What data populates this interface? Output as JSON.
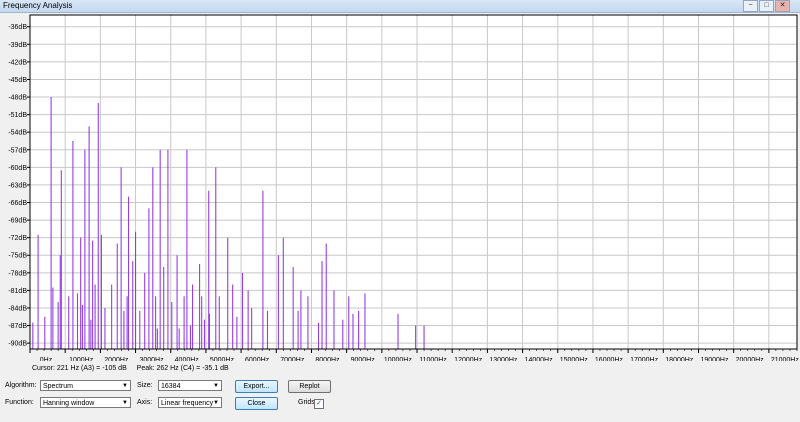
{
  "window": {
    "title": "Frequency Analysis",
    "controls": [
      "−",
      "□",
      "✕"
    ]
  },
  "chart_data": {
    "type": "bar",
    "title": "",
    "xlabel": "",
    "ylabel": "",
    "xlim": [
      0,
      21800
    ],
    "ylim": [
      -91,
      -34
    ],
    "grid": true,
    "x_ticks": [
      0,
      1000,
      2000,
      3000,
      4000,
      5000,
      6000,
      7000,
      8000,
      9000,
      10000,
      11000,
      12000,
      13000,
      14000,
      15000,
      16000,
      17000,
      18000,
      19000,
      20000,
      21000
    ],
    "x_tick_labels": [
      "0Hz",
      "1000Hz",
      "2000Hz",
      "3000Hz",
      "4000Hz",
      "5000Hz",
      "6000Hz",
      "7000Hz",
      "8000Hz",
      "9000Hz",
      "10000Hz",
      "11000Hz",
      "12000Hz",
      "13000Hz",
      "14000Hz",
      "15000Hz",
      "16000Hz",
      "17000Hz",
      "18000Hz",
      "19000Hz",
      "20000Hz",
      "21000Hz"
    ],
    "y_ticks": [
      -36,
      -39,
      -42,
      -45,
      -48,
      -51,
      -54,
      -57,
      -60,
      -63,
      -66,
      -69,
      -72,
      -75,
      -78,
      -81,
      -84,
      -87,
      -90
    ],
    "y_tick_labels": [
      "-36dB",
      "-39dB",
      "-42dB",
      "-45dB",
      "-48dB",
      "-51dB",
      "-54dB",
      "-57dB",
      "-60dB",
      "-63dB",
      "-66dB",
      "-69dB",
      "-72dB",
      "-75dB",
      "-78dB",
      "-81dB",
      "-84dB",
      "-87dB",
      "-90dB"
    ],
    "floor_db": -91,
    "series": [
      {
        "color": "#8a2be2",
        "values": [
          [
            80,
            -86.5
          ],
          [
            230,
            -71.5
          ],
          [
            420,
            -85.5
          ],
          [
            600,
            -48
          ],
          [
            650,
            -80.5
          ],
          [
            800,
            -83
          ],
          [
            860,
            -75
          ],
          [
            890,
            -60.5
          ],
          [
            1100,
            -82
          ],
          [
            1220,
            -55.5
          ],
          [
            1350,
            -81.5
          ],
          [
            1440,
            -72
          ],
          [
            1490,
            -83.5
          ],
          [
            1560,
            -57
          ],
          [
            1680,
            -53
          ],
          [
            1730,
            -86
          ],
          [
            1780,
            -72.5
          ],
          [
            1850,
            -80
          ],
          [
            1940,
            -49
          ],
          [
            2030,
            -71.5
          ],
          [
            2130,
            -84
          ],
          [
            2320,
            -80
          ],
          [
            2480,
            -73
          ],
          [
            2590,
            -60
          ],
          [
            2670,
            -84.5
          ],
          [
            2760,
            -82
          ],
          [
            2800,
            -65
          ],
          [
            2920,
            -76
          ],
          [
            3000,
            -71
          ],
          [
            3120,
            -84.5
          ],
          [
            3260,
            -78
          ],
          [
            3380,
            -67
          ],
          [
            3490,
            -60
          ],
          [
            3570,
            -82
          ],
          [
            3620,
            -87.5
          ],
          [
            3700,
            -57
          ],
          [
            3800,
            -77
          ],
          [
            3920,
            -57
          ],
          [
            4030,
            -83
          ],
          [
            4180,
            -75
          ],
          [
            4240,
            -87.5
          ],
          [
            4380,
            -82
          ],
          [
            4460,
            -57
          ],
          [
            4560,
            -87
          ],
          [
            4620,
            -80
          ],
          [
            4820,
            -76.5
          ],
          [
            4880,
            -82
          ],
          [
            4960,
            -86
          ],
          [
            5080,
            -64
          ],
          [
            5100,
            -85
          ],
          [
            5280,
            -60
          ],
          [
            5380,
            -82
          ],
          [
            5620,
            -72
          ],
          [
            5760,
            -80
          ],
          [
            5880,
            -85.5
          ],
          [
            6040,
            -78
          ],
          [
            6200,
            -81
          ],
          [
            6300,
            -84
          ],
          [
            6620,
            -64
          ],
          [
            6750,
            -84.5
          ],
          [
            7060,
            -75
          ],
          [
            7200,
            -72
          ],
          [
            7480,
            -77
          ],
          [
            7620,
            -84.5
          ],
          [
            7700,
            -81
          ],
          [
            7900,
            -82
          ],
          [
            8200,
            -86.5
          ],
          [
            8300,
            -76
          ],
          [
            8420,
            -73
          ],
          [
            8640,
            -81
          ],
          [
            8890,
            -86
          ],
          [
            9060,
            -82
          ],
          [
            9180,
            -85
          ],
          [
            9340,
            -84.5
          ],
          [
            9520,
            -81.5
          ],
          [
            10460,
            -85
          ],
          [
            10960,
            -87
          ],
          [
            11200,
            -87
          ]
        ]
      }
    ]
  },
  "status": {
    "cursor": "Cursor: 221 Hz (A3) = -105 dB",
    "peak": "Peak: 262 Hz (C4) = -35.1 dB"
  },
  "controls": {
    "algorithm_label": "Algorithm:",
    "algorithm_value": "Spectrum",
    "size_label": "Size:",
    "size_value": "16384",
    "export_label": "Export...",
    "replot_label": "Replot",
    "function_label": "Function:",
    "function_value": "Hanning window",
    "axis_label": "Axis:",
    "axis_value": "Linear frequency",
    "close_label": "Close",
    "grids_label": "Grids",
    "grids_checked": "✓"
  }
}
